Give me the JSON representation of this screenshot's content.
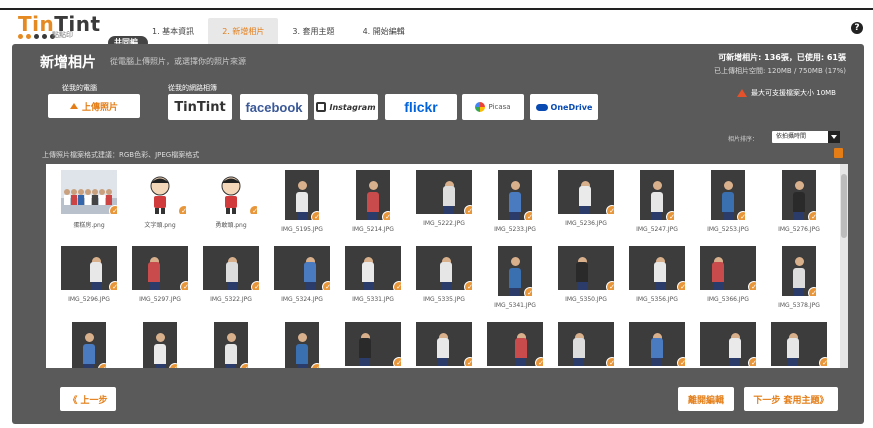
{
  "header": {
    "logo_a": "Tin",
    "logo_b": "Tint",
    "logo_sub": "點點印",
    "badge": "共同編輯",
    "steps": [
      {
        "label": "1. 基本資訊",
        "active": false
      },
      {
        "label": "2. 新增相片",
        "active": true
      },
      {
        "label": "3. 套用主題",
        "active": false
      },
      {
        "label": "4. 開始編輯",
        "active": false
      }
    ],
    "help": "?"
  },
  "panel": {
    "title": "新增相片",
    "subtitle": "從電腦上傳照片，或選擇你的照片來源",
    "quota_line1": "可新增相片: 136張，已使用: 61張",
    "quota_line2": "已上傳相片空間: 120MB / 750MB (17%)",
    "source_from_computer": "從我的電腦",
    "source_from_web": "從我的網路相簿",
    "upload_button": "上傳照片",
    "services": {
      "tintint": "TinTint",
      "facebook": "facebook",
      "instagram": "Instagram",
      "flickr": "flickr",
      "picasa": "Picasa",
      "onedrive": "OneDrive"
    },
    "max_size": "最大可支援檔案大小 10MB",
    "sort_label": "相片排序：",
    "sort_value": "依拍攝時間",
    "format_note": "上傳照片檔案格式建議：RGB色彩、JPEG檔案格式"
  },
  "photos": [
    {
      "name": "蛋糕房.png",
      "kind": "group"
    },
    {
      "name": "文字頭.png",
      "kind": "icon"
    },
    {
      "name": "勇敢頭.png",
      "kind": "icon"
    },
    {
      "name": "IMG_5195.JPG",
      "kind": "portrait"
    },
    {
      "name": "IMG_5214.JPG",
      "kind": "portrait"
    },
    {
      "name": "IMG_5222.JPG",
      "kind": "wide"
    },
    {
      "name": "IMG_5233.JPG",
      "kind": "portrait"
    },
    {
      "name": "IMG_5236.JPG",
      "kind": "wide"
    },
    {
      "name": "IMG_5247.JPG",
      "kind": "portrait"
    },
    {
      "name": "IMG_5253.JPG",
      "kind": "portrait"
    },
    {
      "name": "IMG_5276.JPG",
      "kind": "portrait"
    },
    {
      "name": "IMG_5296.JPG",
      "kind": "wide"
    },
    {
      "name": "IMG_5297.JPG",
      "kind": "wide"
    },
    {
      "name": "IMG_5322.JPG",
      "kind": "wide"
    },
    {
      "name": "IMG_5324.JPG",
      "kind": "wide"
    },
    {
      "name": "IMG_5331.JPG",
      "kind": "wide"
    },
    {
      "name": "IMG_5335.JPG",
      "kind": "wide"
    },
    {
      "name": "IMG_5341.JPG",
      "kind": "portrait"
    },
    {
      "name": "IMG_5350.JPG",
      "kind": "wide"
    },
    {
      "name": "IMG_5356.JPG",
      "kind": "wide"
    },
    {
      "name": "IMG_5366.JPG",
      "kind": "wide"
    },
    {
      "name": "IMG_5378.JPG",
      "kind": "portrait"
    },
    {
      "name": "",
      "kind": "portrait"
    },
    {
      "name": "",
      "kind": "portrait"
    },
    {
      "name": "",
      "kind": "portrait"
    },
    {
      "name": "",
      "kind": "portrait"
    },
    {
      "name": "",
      "kind": "wide"
    },
    {
      "name": "",
      "kind": "wide"
    },
    {
      "name": "",
      "kind": "wide"
    },
    {
      "name": "",
      "kind": "wide"
    },
    {
      "name": "",
      "kind": "wide"
    },
    {
      "name": "",
      "kind": "wide"
    },
    {
      "name": "",
      "kind": "wide"
    }
  ],
  "footer": {
    "prev": "《 上一步",
    "quit": "離開編輯",
    "next": "下一步 套用主題》"
  },
  "colors": {
    "accent": "#e47d16",
    "panel": "#5a5a5a",
    "facebook": "#3b5998",
    "flickr": "#0063dc",
    "onedrive": "#094ab2"
  }
}
